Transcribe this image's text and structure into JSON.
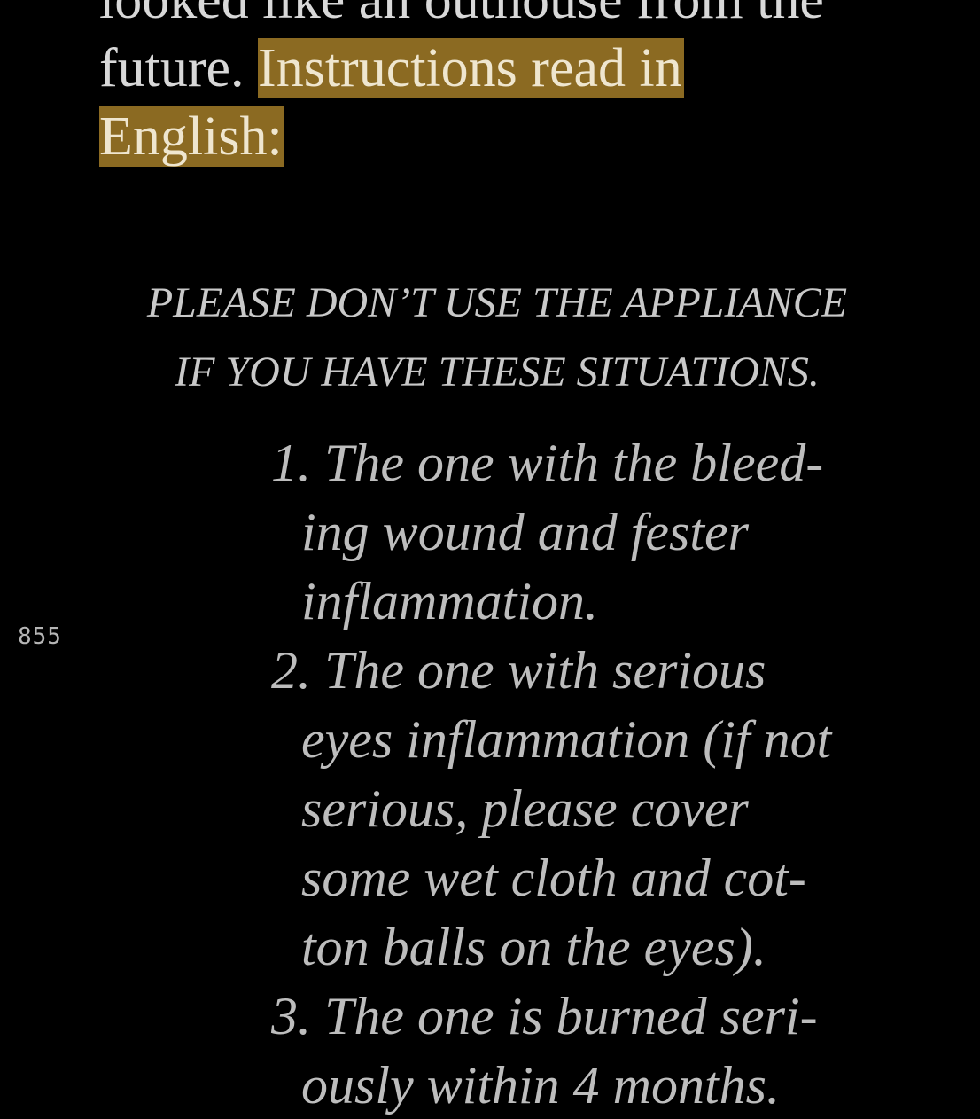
{
  "passage": {
    "line_top_partial": "looked like an outhouse from the",
    "line_2_prefix": "future.",
    "highlight_part1": "Instructions read in",
    "highlight_part2": "English:"
  },
  "notice": {
    "line1": "PLEASE DON’T USE THE APPLIANCE",
    "line2": "IF YOU HAVE THESE SITUATIONS."
  },
  "list": [
    {
      "number": "1.",
      "lines": [
        "The one with the bleed-",
        "ing wound and fester",
        "inflammation."
      ]
    },
    {
      "number": "2.",
      "lines": [
        "The one with serious",
        "eyes inflammation (if not",
        "serious, please cover",
        "some wet cloth and cot-",
        "ton balls on the eyes)."
      ]
    },
    {
      "number": "3.",
      "lines": [
        "The one is burned seri-",
        "ously within 4 months."
      ]
    }
  ],
  "page_number": "855",
  "colors": {
    "background": "#000000",
    "highlight": "#8b6a22",
    "text": "#d8d8d8"
  }
}
